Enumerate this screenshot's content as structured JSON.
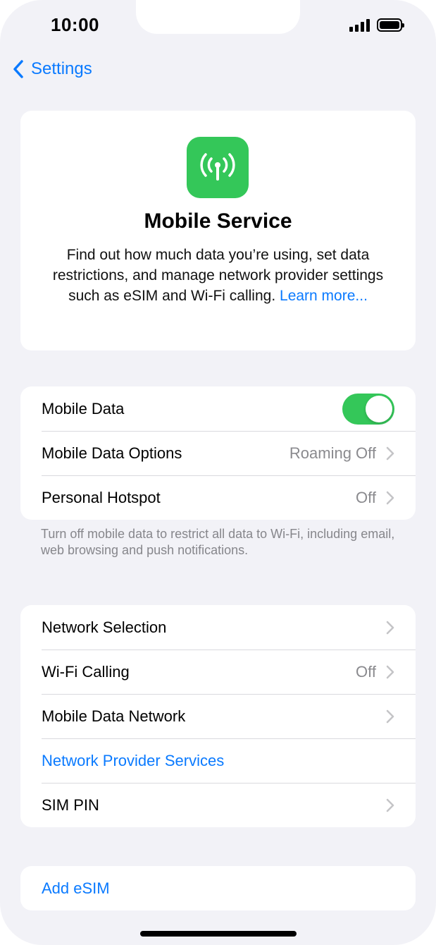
{
  "status_bar": {
    "time": "10:00"
  },
  "nav": {
    "back_label": "Settings"
  },
  "hero": {
    "icon": "antenna-icon",
    "icon_color": "#34c759",
    "title": "Mobile Service",
    "description": "Find out how much data you’re using, set data restrictions, and manage network provider settings such as eSIM and Wi-Fi calling.",
    "learn_more": "Learn more..."
  },
  "data_group": {
    "mobile_data": {
      "label": "Mobile Data",
      "enabled": true
    },
    "options": {
      "label": "Mobile Data Options",
      "value": "Roaming Off"
    },
    "hotspot": {
      "label": "Personal Hotspot",
      "value": "Off"
    },
    "footnote": "Turn off mobile data to restrict all data to Wi-Fi, including email, web browsing and push notifications."
  },
  "network_group": {
    "network_selection": {
      "label": "Network Selection"
    },
    "wifi_calling": {
      "label": "Wi-Fi Calling",
      "value": "Off"
    },
    "data_network": {
      "label": "Mobile Data Network"
    },
    "provider_services": {
      "label": "Network Provider Services"
    },
    "sim_pin": {
      "label": "SIM PIN"
    }
  },
  "esim_group": {
    "add_esim": {
      "label": "Add eSIM"
    }
  },
  "colors": {
    "accent": "#0a7aff",
    "toggle_on": "#34c759",
    "background": "#f2f2f7"
  }
}
